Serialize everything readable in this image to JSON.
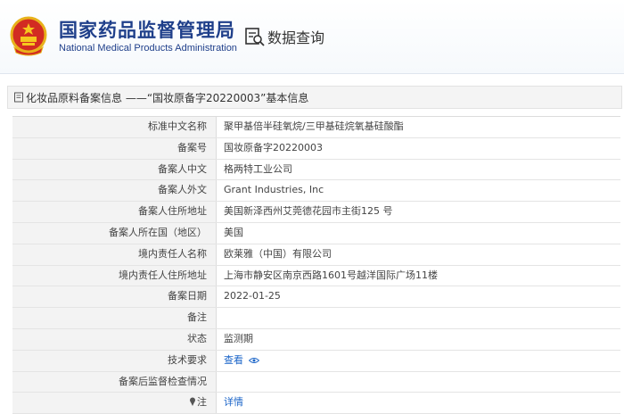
{
  "header": {
    "site_title_cn": "国家药品监督管理局",
    "site_title_en": "National Medical Products Administration",
    "query_tab_label": "数据查询",
    "emblem_icon": "national-emblem-icon",
    "query_icon": "data-query-icon"
  },
  "breadcrumb": {
    "text": "化妆品原料备案信息 ——“国妆原备字20220003”基本信息",
    "icon": "document-icon"
  },
  "rows": [
    {
      "label": "标准中文名称",
      "value": "聚甲基倍半硅氧烷/三甲基硅烷氧基硅酸酯"
    },
    {
      "label": "备案号",
      "value": "国妆原备字20220003"
    },
    {
      "label": "备案人中文",
      "value": "格两特工业公司"
    },
    {
      "label": "备案人外文",
      "value": "Grant Industries, Inc"
    },
    {
      "label": "备案人住所地址",
      "value": "美国新泽西州艾莞德花园市主街125 号"
    },
    {
      "label": "备案人所在国（地区）",
      "value": "美国"
    },
    {
      "label": "境内责任人名称",
      "value": "欧莱雅（中国）有限公司"
    },
    {
      "label": "境内责任人住所地址",
      "value": "上海市静安区南京西路1601号越洋国际广场11楼"
    },
    {
      "label": "备案日期",
      "value": "2022-01-25"
    },
    {
      "label": "备注",
      "value": ""
    },
    {
      "label": "状态",
      "value": "监测期"
    },
    {
      "label": "技术要求",
      "value": "查看"
    },
    {
      "label": "备案后监督检查情况",
      "value": ""
    },
    {
      "label": "注",
      "value": "详情"
    }
  ],
  "colors": {
    "brand_blue": "#1f3f8a",
    "link_blue": "#1a64c8",
    "label_bg": "#f3f3f3"
  }
}
